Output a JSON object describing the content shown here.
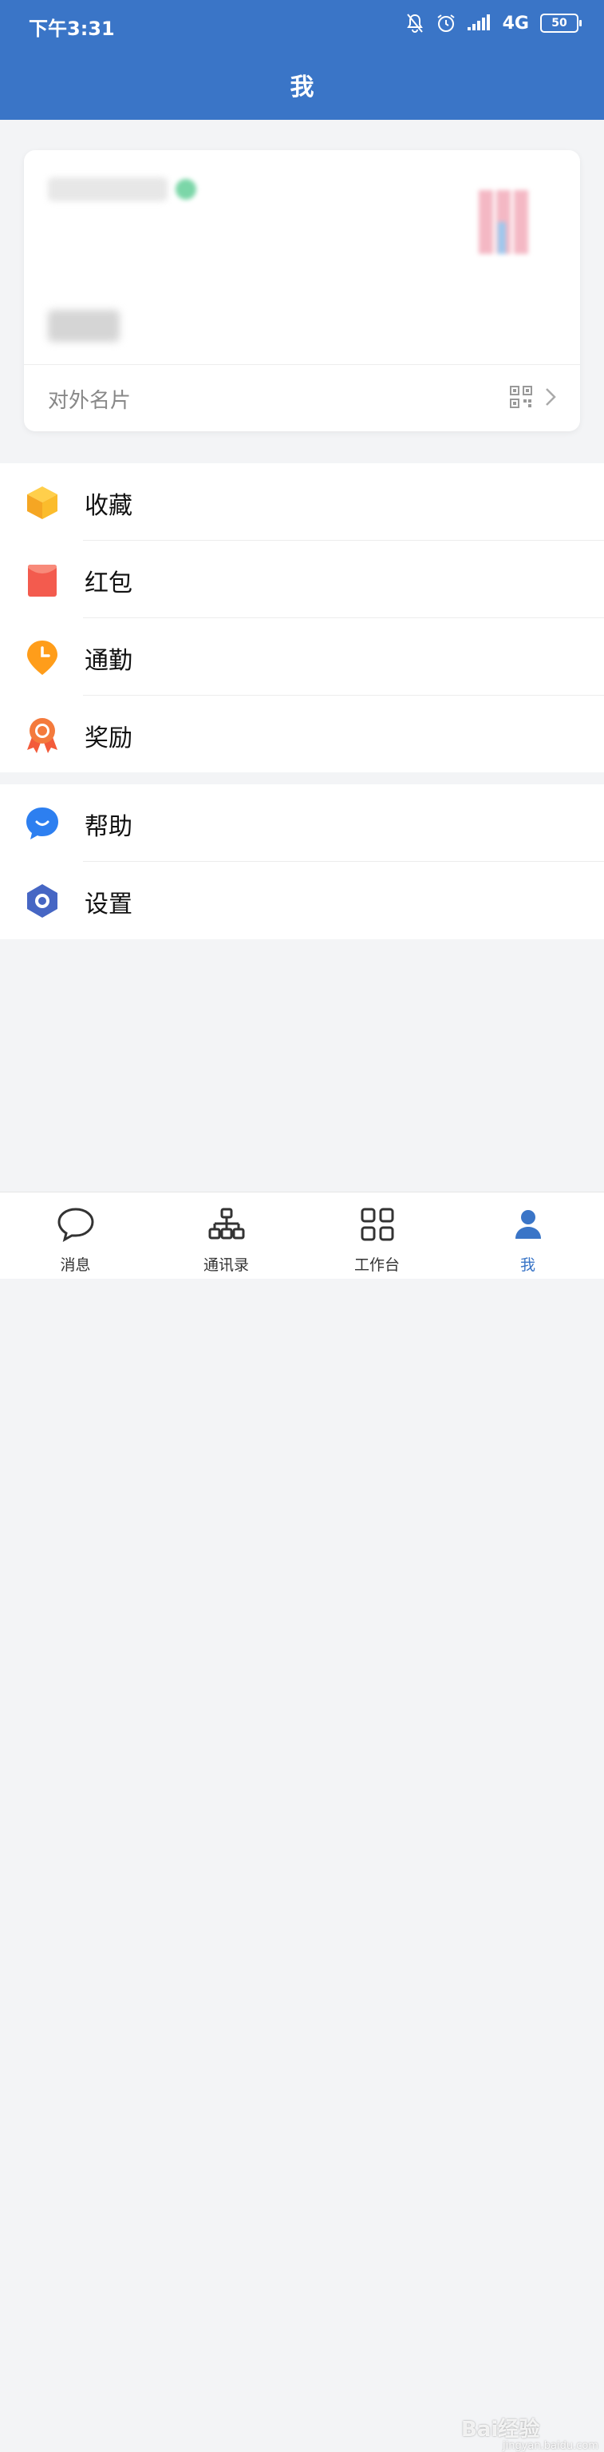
{
  "status": {
    "time": "下午3:31",
    "network": "4G",
    "battery": "50"
  },
  "header": {
    "title": "我"
  },
  "profile_card": {
    "business_card_label": "对外名片"
  },
  "menu_group_1": [
    {
      "label": "收藏",
      "icon": "favorites-box-icon"
    },
    {
      "label": "红包",
      "icon": "red-envelope-icon"
    },
    {
      "label": "通勤",
      "icon": "commute-location-clock-icon"
    },
    {
      "label": "奖励",
      "icon": "reward-medal-icon"
    }
  ],
  "menu_group_2": [
    {
      "label": "帮助",
      "icon": "help-chat-icon"
    },
    {
      "label": "设置",
      "icon": "settings-hexagon-icon"
    }
  ],
  "tabbar": [
    {
      "label": "消息",
      "icon": "message-bubble-icon"
    },
    {
      "label": "通讯录",
      "icon": "contacts-org-icon"
    },
    {
      "label": "工作台",
      "icon": "workbench-grid-icon"
    },
    {
      "label": "我",
      "icon": "me-person-icon",
      "active": true
    }
  ],
  "watermark": {
    "text": "Bai经验",
    "sub": "jingyan.baidu.com"
  },
  "colors": {
    "primary": "#3a75c7",
    "background": "#f3f4f6"
  }
}
